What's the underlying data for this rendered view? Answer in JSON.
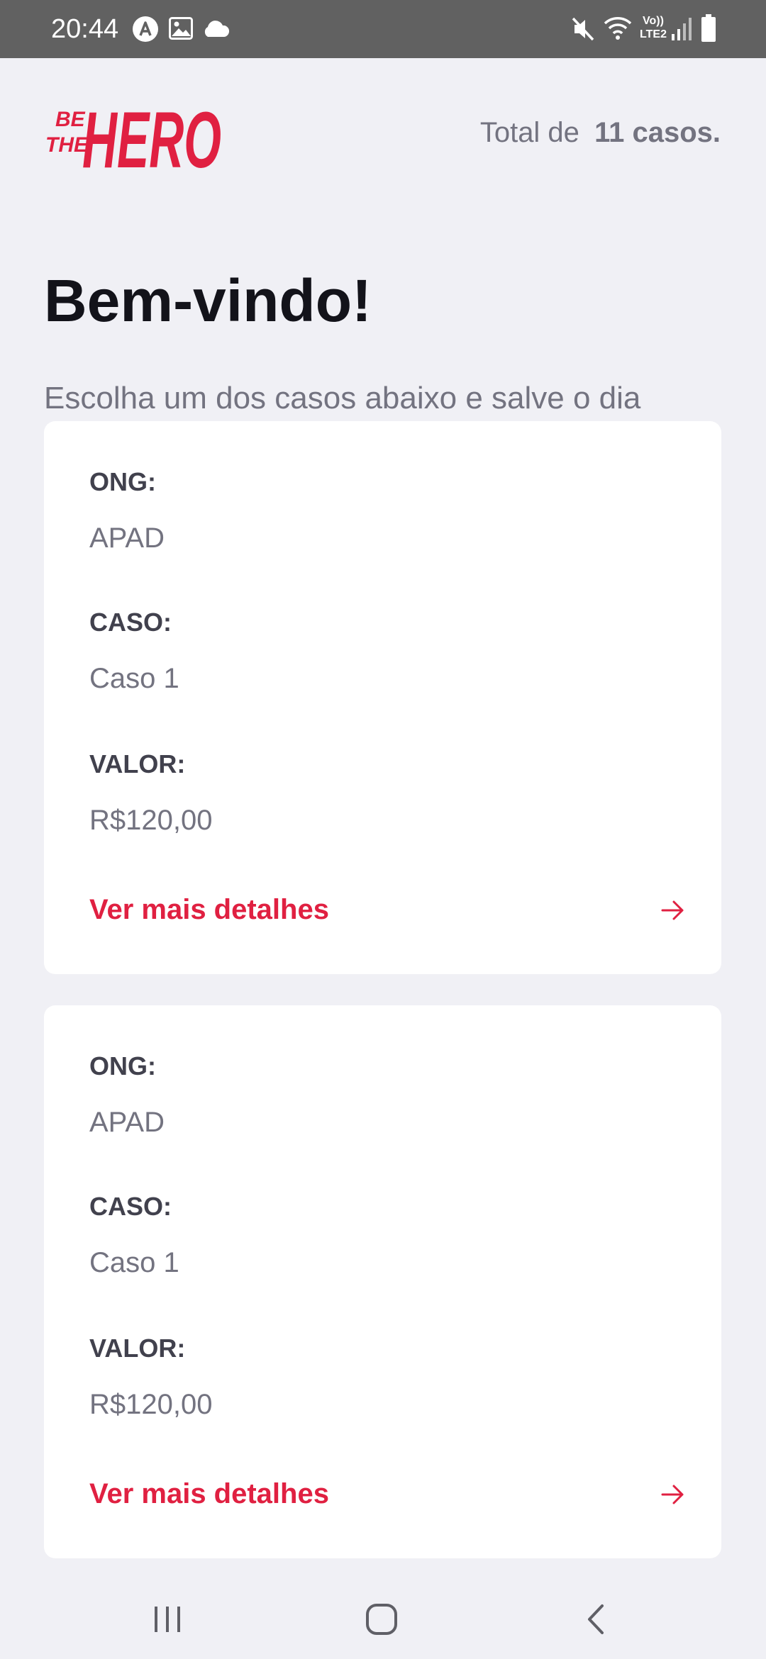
{
  "status_bar": {
    "time": "20:44",
    "network_label_top": "Vo))",
    "network_label_bottom": "LTE2",
    "icons": [
      "app-notification-icon",
      "image-icon",
      "cloud-icon",
      "mute-icon",
      "wifi-icon",
      "signal-icon",
      "battery-icon"
    ]
  },
  "header": {
    "logo_top": "BE",
    "logo_mid": "THE",
    "logo_main": "HERO",
    "total_prefix": "Total de",
    "total_count": "11 casos."
  },
  "page": {
    "title": "Bem-vindo!",
    "subtitle": "Escolha um dos casos abaixo e salve o dia"
  },
  "incidents": [
    {
      "ong_label": "ONG:",
      "ong_value": "APAD",
      "caso_label": "CASO:",
      "caso_value": "Caso 1",
      "valor_label": "VALOR:",
      "valor_value": "R$120,00",
      "details_label": "Ver mais detalhes"
    },
    {
      "ong_label": "ONG:",
      "ong_value": "APAD",
      "caso_label": "CASO:",
      "caso_value": "Caso 1",
      "valor_label": "VALOR:",
      "valor_value": "R$120,00",
      "details_label": "Ver mais detalhes"
    }
  ],
  "nav_bar": {
    "icons": [
      "recent-apps-icon",
      "home-icon",
      "back-icon"
    ]
  },
  "colors": {
    "brand": "#E02041",
    "background": "#F0F0F5",
    "title": "#13131A",
    "muted": "#737380",
    "label": "#41414D",
    "status_bar": "#616161"
  }
}
